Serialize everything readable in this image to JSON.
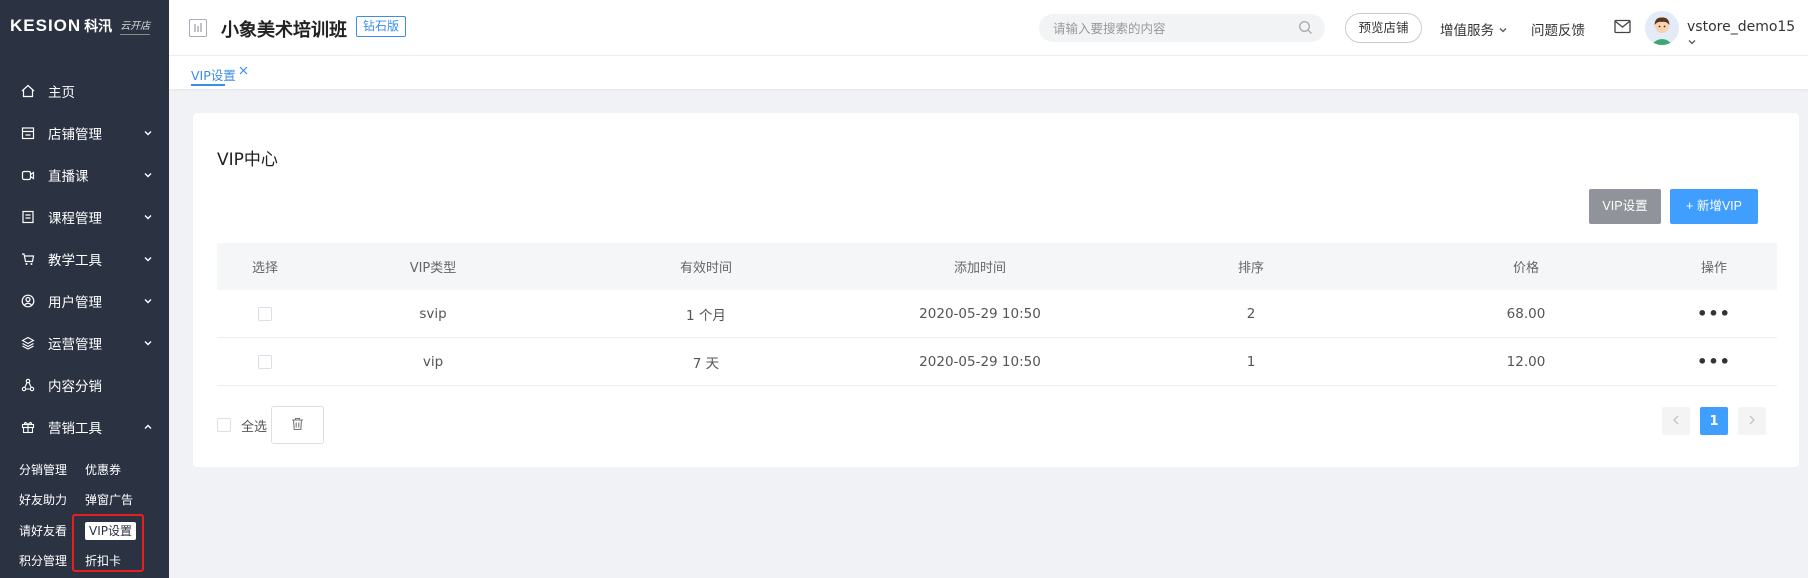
{
  "logo": {
    "brand": "KESION",
    "brand_cn": "科汛",
    "script": "云开店"
  },
  "sidebar": {
    "items": [
      {
        "label": "主页",
        "icon": "home-icon",
        "expandable": false
      },
      {
        "label": "店铺管理",
        "icon": "store-icon",
        "expandable": true
      },
      {
        "label": "直播课",
        "icon": "video-icon",
        "expandable": true
      },
      {
        "label": "课程管理",
        "icon": "course-icon",
        "expandable": true
      },
      {
        "label": "教学工具",
        "icon": "cart-icon",
        "expandable": true
      },
      {
        "label": "用户管理",
        "icon": "user-icon",
        "expandable": true
      },
      {
        "label": "运营管理",
        "icon": "layers-icon",
        "expandable": true
      },
      {
        "label": "内容分销",
        "icon": "share-icon",
        "expandable": false
      },
      {
        "label": "营销工具",
        "icon": "gift-icon",
        "expandable": true,
        "expanded": true
      }
    ],
    "submenu": [
      [
        "分销管理",
        "优惠券"
      ],
      [
        "好友助力",
        "弹窗广告"
      ],
      [
        "请好友看",
        "VIP设置"
      ],
      [
        "积分管理",
        "折扣卡"
      ]
    ],
    "active_sub": "VIP设置"
  },
  "header": {
    "store_name": "小象美术培训班",
    "badge": "钻石版",
    "search_placeholder": "请输入要搜索的内容",
    "preview": "预览店铺",
    "value_service": "增值服务",
    "feedback": "问题反馈",
    "username": "vstore_demo15"
  },
  "tabs": [
    {
      "label": "VIP设置",
      "active": true
    }
  ],
  "main": {
    "title": "VIP中心",
    "btn_settings": "VIP设置",
    "btn_add": "新增VIP",
    "columns": [
      "选择",
      "VIP类型",
      "有效时间",
      "添加时间",
      "排序",
      "价格",
      "操作"
    ],
    "rows": [
      {
        "type": "svip",
        "duration": "1 个月",
        "added": "2020-05-29 10:50",
        "sort": "2",
        "price": "68.00"
      },
      {
        "type": "vip",
        "duration": "7 天",
        "added": "2020-05-29 10:50",
        "sort": "1",
        "price": "12.00"
      }
    ],
    "select_all": "全选",
    "pagination": {
      "current": "1"
    }
  },
  "colors": {
    "sidebar_bg": "#2b3241",
    "primary": "#409eff",
    "gray_button": "#909399",
    "highlight": "#e81f1f"
  }
}
